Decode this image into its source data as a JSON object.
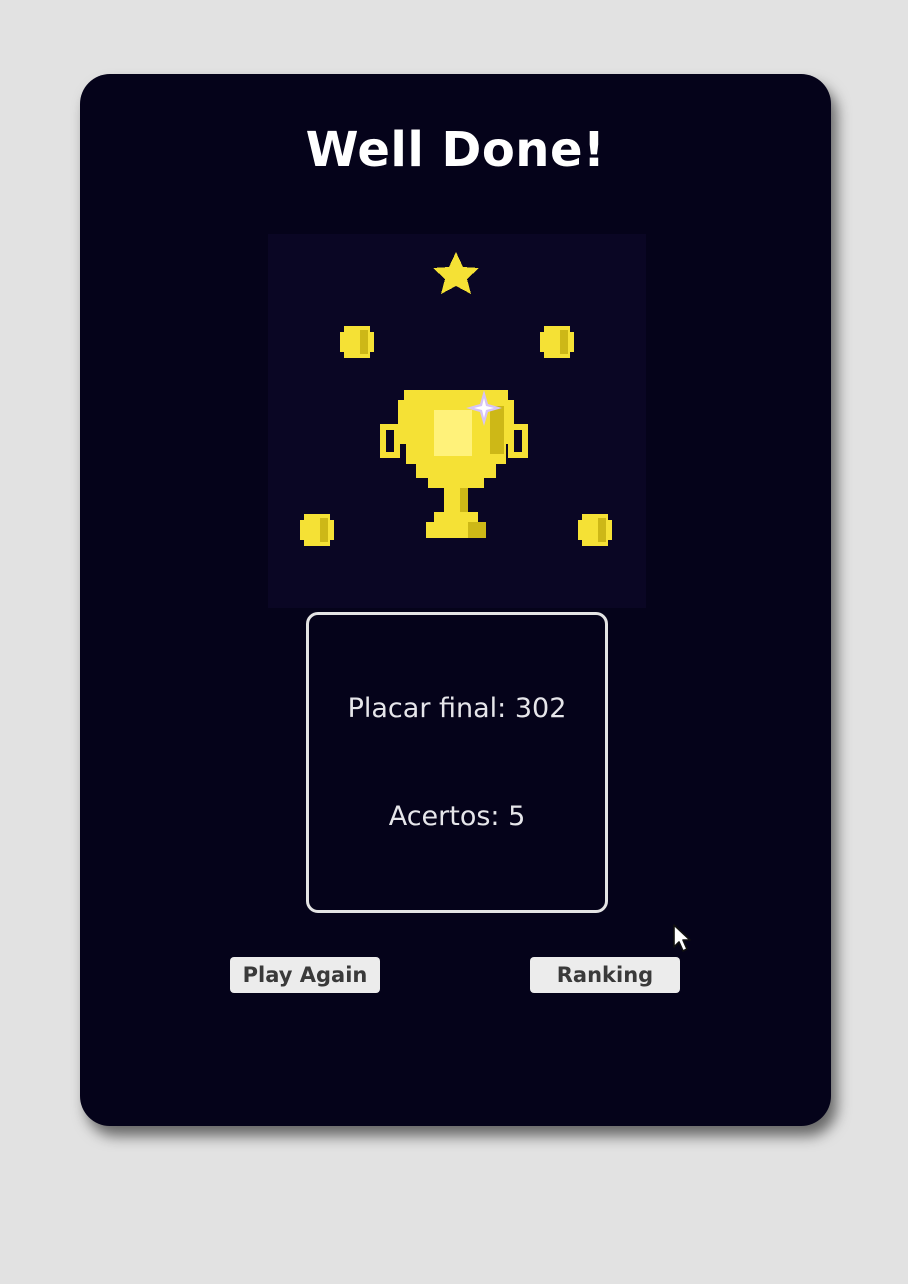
{
  "screen": {
    "title": "Well Done!"
  },
  "trophy_art": {
    "icons": [
      "star-icon",
      "coin-icon",
      "trophy-icon",
      "sparkle-icon"
    ],
    "colors": {
      "gold": "#f5e135",
      "gold_shadow": "#cdb817",
      "gold_highlight": "#fff27a",
      "sparkle": "#d7c4f5",
      "art_background": "#0a0624"
    }
  },
  "score": {
    "final_label": "Placar final: 302",
    "hits_label": "Acertos: 5"
  },
  "actions": {
    "play_again": "Play Again",
    "ranking": "Ranking"
  },
  "colors": {
    "page_background": "#e2e2e2",
    "card_background": "#05031a",
    "text": "#ffffff",
    "button_background": "#ececec",
    "button_text": "#3a3a3a"
  }
}
